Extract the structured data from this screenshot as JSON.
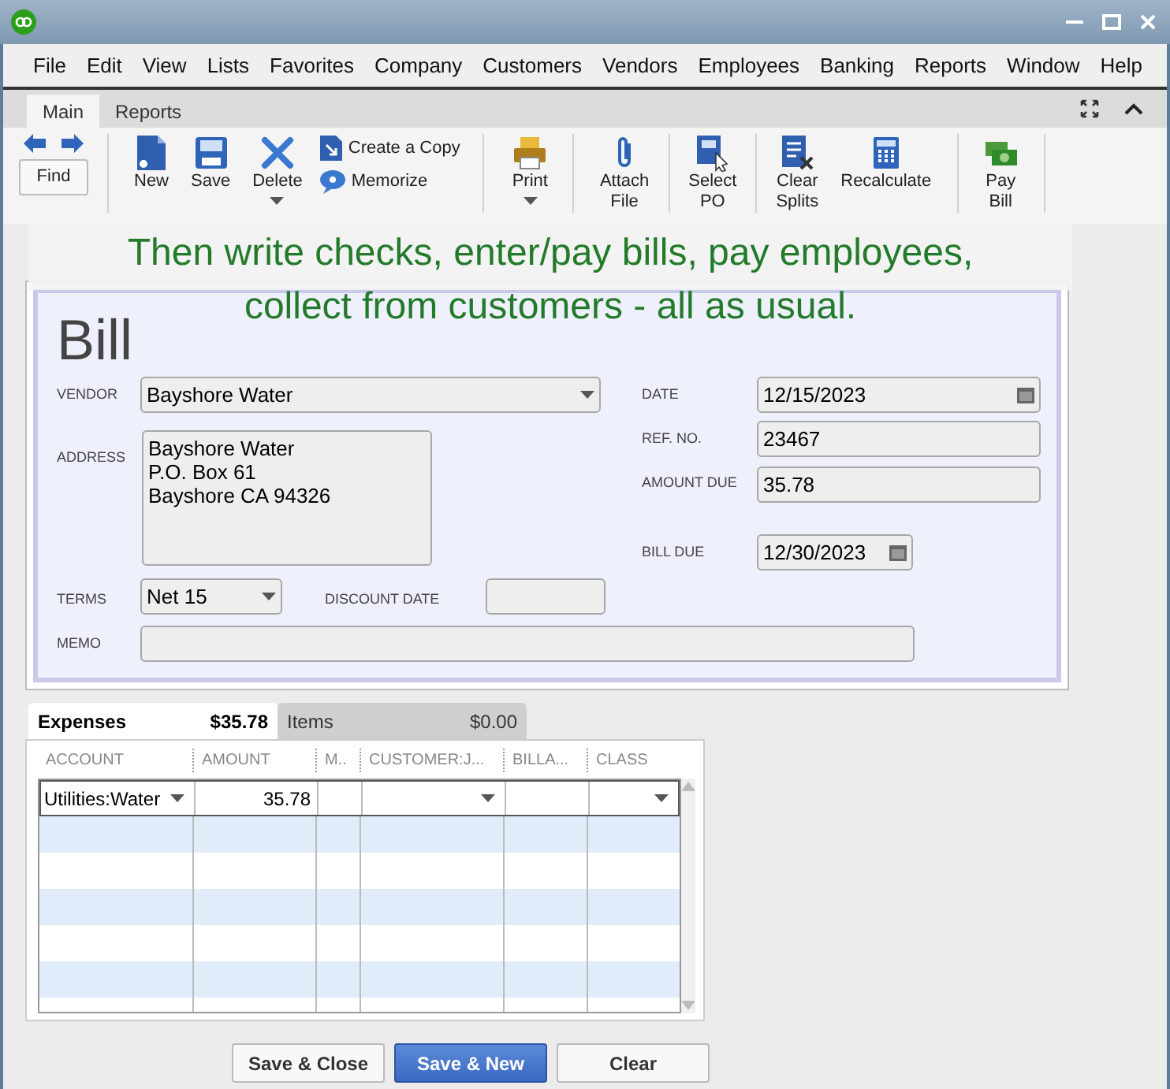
{
  "menu": [
    "File",
    "Edit",
    "View",
    "Lists",
    "Favorites",
    "Company",
    "Customers",
    "Vendors",
    "Employees",
    "Banking",
    "Reports",
    "Window",
    "Help"
  ],
  "ribbon_tabs": [
    {
      "label": "Main",
      "selected": true
    },
    {
      "label": "Reports",
      "selected": false
    }
  ],
  "toolbar": [
    {
      "label": "Find",
      "has_menu": false
    },
    {
      "label": "New",
      "has_menu": false
    },
    {
      "label": "Save",
      "has_menu": false
    },
    {
      "label": "Delete",
      "has_menu": true
    },
    {
      "label": "Create a Copy",
      "has_menu": false
    },
    {
      "label": "Memorize",
      "has_menu": false
    },
    {
      "label": "Print",
      "has_menu": true
    },
    {
      "label": "Attach\nFile",
      "has_menu": false
    },
    {
      "label": "Select\nPO",
      "has_menu": false
    },
    {
      "label": "Clear\nSplits",
      "has_menu": false
    },
    {
      "label": "Recalculate",
      "has_menu": false
    },
    {
      "label": "Pay\nBill",
      "has_menu": false
    }
  ],
  "caption": "Then write checks, enter/pay bills, pay employees, collect from customers - all as usual.",
  "form": {
    "title": "Bill",
    "vendor": {
      "label": "VENDOR",
      "value": "Bayshore Water"
    },
    "address": {
      "label": "ADDRESS",
      "lines": [
        "Bayshore Water",
        "P.O. Box 61",
        "Bayshore CA 94326"
      ]
    },
    "terms": {
      "label": "TERMS",
      "value": "Net 15"
    },
    "discount_date": {
      "label": "DISCOUNT DATE"
    },
    "memo": {
      "label": "MEMO"
    },
    "date": {
      "label": "DATE",
      "value": "12/15/2023"
    },
    "ref_no": {
      "label": "REF. NO.",
      "value": "23467"
    },
    "amount_due": {
      "label": "AMOUNT DUE",
      "value": "35.78"
    },
    "bill_due": {
      "label": "BILL DUE",
      "value": "12/30/2023"
    }
  },
  "detail_tabs": [
    {
      "label": "Expenses",
      "amount": "$35.78",
      "selected": true
    },
    {
      "label": "Items",
      "amount": "$0.00",
      "selected": false
    }
  ],
  "columns": [
    "ACCOUNT",
    "AMOUNT",
    "M..",
    "CUSTOMER:J...",
    "BILLA...",
    "CLASS"
  ],
  "rows": [
    {
      "account": "Utilities:Water",
      "amount": "35.78"
    }
  ],
  "buttons": [
    {
      "label": "Save & Close",
      "primary": false
    },
    {
      "label": "Save & New",
      "primary": true
    },
    {
      "label": "Clear",
      "primary": false
    }
  ]
}
